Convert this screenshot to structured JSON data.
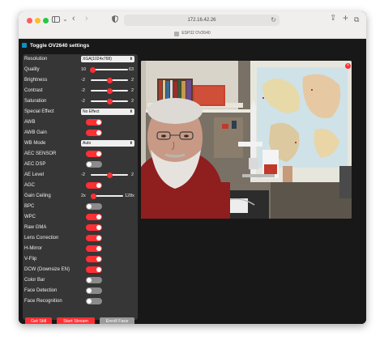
{
  "browser": {
    "url": "172.16.42.26",
    "tab_title": "ESP32 OV2640"
  },
  "icons": {
    "sidebar": "sidebar-icon",
    "back": "chevron-left-icon",
    "forward": "chevron-right-icon",
    "privacy": "shield-icon",
    "reload": "reload-icon",
    "share": "share-icon",
    "new_tab": "plus-icon",
    "tabs": "tabs-overview-icon",
    "menu": "hamburger-icon",
    "close": "close-icon"
  },
  "colors": {
    "accent": "#ff3034",
    "panel_bg": "#363636",
    "page_bg": "#181818",
    "menu_icon": "#0c90c4",
    "disabled_button": "#9a9a9a"
  },
  "menu": {
    "title": "Toggle OV2640 settings"
  },
  "settings": {
    "resolution": {
      "label": "Resolution",
      "value": "XGA(1024x768)"
    },
    "quality": {
      "label": "Quality",
      "min": "10",
      "max": "63",
      "value": 10
    },
    "brightness": {
      "label": "Brightness",
      "min": "-2",
      "max": "2",
      "value": 0
    },
    "contrast": {
      "label": "Contrast",
      "min": "-2",
      "max": "2",
      "value": 0
    },
    "saturation": {
      "label": "Saturation",
      "min": "-2",
      "max": "2",
      "value": 0
    },
    "special_effect": {
      "label": "Special Effect",
      "value": "No Effect"
    },
    "awb": {
      "label": "AWB",
      "on": true
    },
    "awb_gain": {
      "label": "AWB Gain",
      "on": true
    },
    "wb_mode": {
      "label": "WB Mode",
      "value": "Auto"
    },
    "aec_sensor": {
      "label": "AEC SENSOR",
      "on": true
    },
    "aec_dsp": {
      "label": "AEC DSP",
      "on": false
    },
    "ae_level": {
      "label": "AE Level",
      "min": "-2",
      "max": "2",
      "value": 0
    },
    "agc": {
      "label": "AGC",
      "on": true
    },
    "gain_ceiling": {
      "label": "Gain Ceiling",
      "min": "2x",
      "max": "128x",
      "value": 0
    },
    "bpc": {
      "label": "BPC",
      "on": false
    },
    "wpc": {
      "label": "WPC",
      "on": true
    },
    "raw_gma": {
      "label": "Raw GMA",
      "on": true
    },
    "lens_correction": {
      "label": "Lens Correction",
      "on": true
    },
    "h_mirror": {
      "label": "H-Mirror",
      "on": true
    },
    "v_flip": {
      "label": "V-Flip",
      "on": true
    },
    "dcw": {
      "label": "DCW (Downsize EN)",
      "on": true
    },
    "color_bar": {
      "label": "Color Bar",
      "on": false
    },
    "face_detection": {
      "label": "Face Detection",
      "on": false
    },
    "face_recognition": {
      "label": "Face Recognition",
      "on": false
    }
  },
  "buttons": {
    "get_still": "Get Still",
    "start_stream": "Start Stream",
    "enroll_face": "Enroll Face"
  },
  "stream": {
    "close_glyph": "×"
  }
}
